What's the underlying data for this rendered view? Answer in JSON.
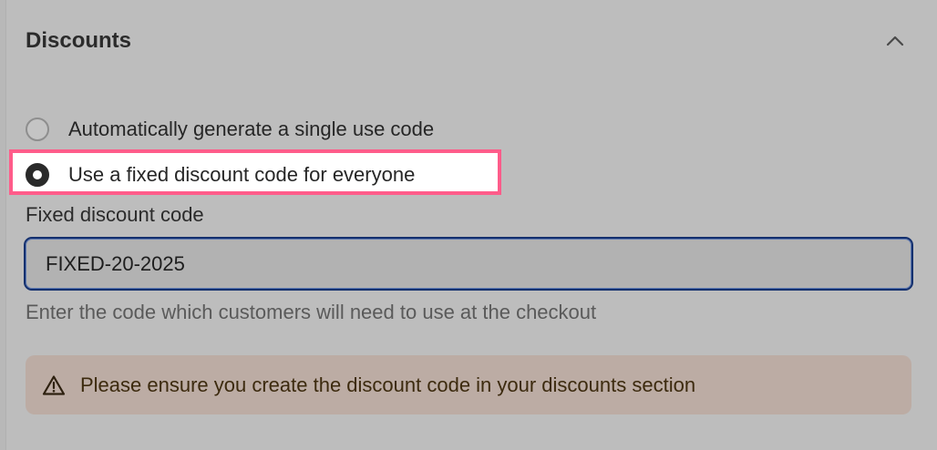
{
  "section": {
    "title": "Discounts",
    "collapse_icon": "chevron-up-icon"
  },
  "options": [
    {
      "label": "Automatically generate a single use code",
      "selected": false
    },
    {
      "label": "Use a fixed discount code for everyone",
      "selected": true
    }
  ],
  "fixed_code": {
    "label": "Fixed discount code",
    "value": "FIXED-20-2025",
    "help": "Enter the code which customers will need to use at the checkout"
  },
  "warning": {
    "icon": "warning-triangle-icon",
    "text": "Please ensure you create the discount code in your discounts section"
  },
  "colors": {
    "highlight_border": "#ff5c8a",
    "input_focus_border": "#14306e",
    "warning_background": "#bcaca4"
  }
}
